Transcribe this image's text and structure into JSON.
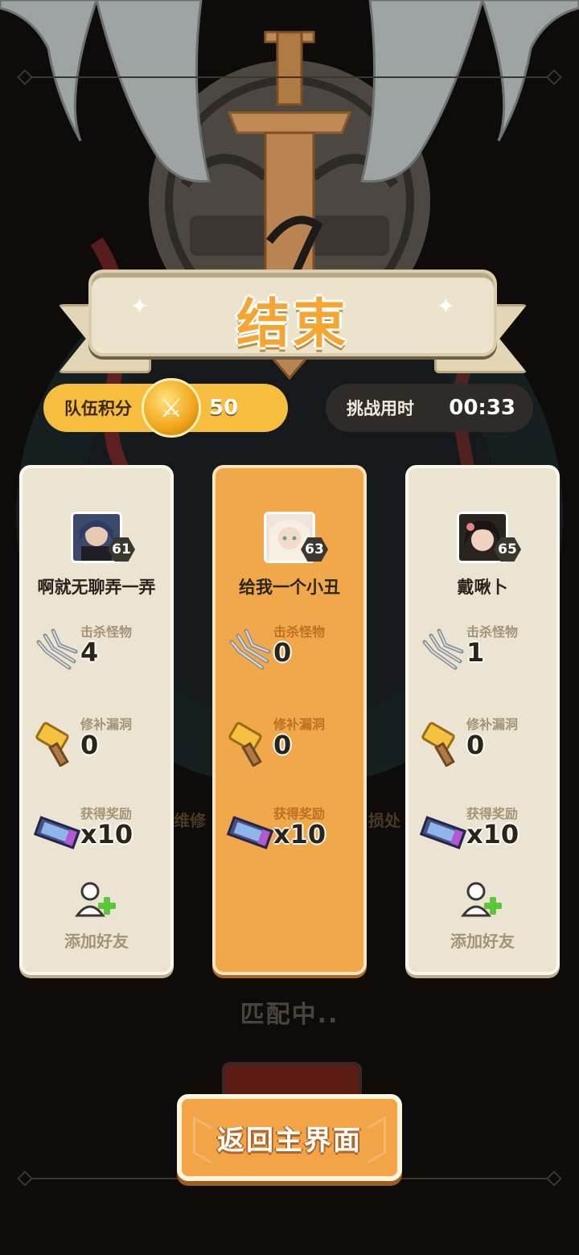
{
  "banner": {
    "title": "结束"
  },
  "score": {
    "label": "队伍积分",
    "value": "50"
  },
  "time": {
    "label": "挑战用时",
    "value": "00:33"
  },
  "stat_labels": {
    "kills": "击杀怪物",
    "repairs": "修补漏洞",
    "rewards": "获得奖励"
  },
  "players": [
    {
      "name": "啊就无聊弄一弄",
      "level": "61",
      "kills": "4",
      "repairs": "0",
      "rewards": "x10",
      "add_friend": "添加好友"
    },
    {
      "name": "给我一个小丑",
      "level": "63",
      "kills": "0",
      "repairs": "0",
      "rewards": "x10",
      "self": true
    },
    {
      "name": "戴啾卜",
      "level": "65",
      "kills": "1",
      "repairs": "0",
      "rewards": "x10",
      "add_friend": "添加好友"
    }
  ],
  "background": {
    "matching_text": "匹配中..",
    "ghost_text_left": "维修",
    "ghost_text_right": "损处"
  },
  "return_button": {
    "label": "返回主界面"
  },
  "colors": {
    "accent": "#f3a446",
    "card": "#ece4d2",
    "gold": "#f6bd3e"
  }
}
